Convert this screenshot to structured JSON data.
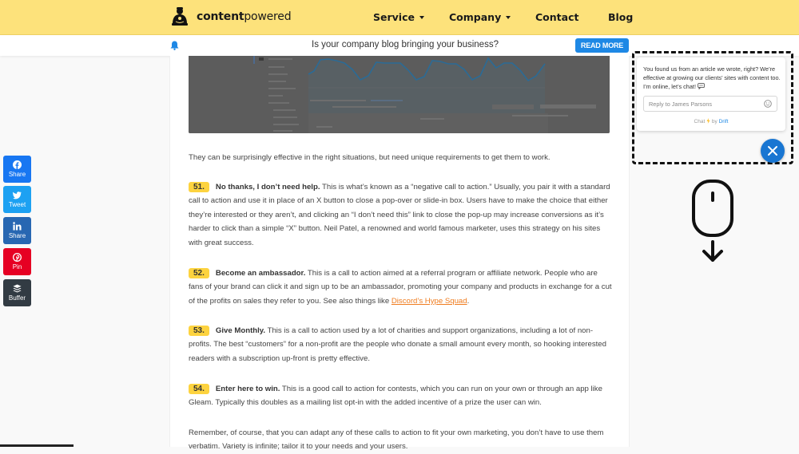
{
  "header": {
    "logo": {
      "name_bold": "content",
      "name_regular": "powered"
    },
    "nav": [
      {
        "label": "Service",
        "has_dropdown": true
      },
      {
        "label": "Company",
        "has_dropdown": true
      },
      {
        "label": "Contact",
        "has_dropdown": false
      },
      {
        "label": "Blog",
        "has_dropdown": false
      }
    ]
  },
  "notice_bar": {
    "icon": "bell-icon",
    "text": "Is your company blog bringing your business?",
    "button_label": "READ MORE",
    "accent": "#1e88e5"
  },
  "social_share": [
    {
      "network": "facebook",
      "icon": "facebook-icon",
      "label": "Share",
      "color": "#1877f2"
    },
    {
      "network": "twitter",
      "icon": "twitter-icon",
      "label": "Tweet",
      "color": "#1da1f2"
    },
    {
      "network": "linkedin",
      "icon": "linkedin-icon",
      "label": "Share",
      "color": "#2867b2"
    },
    {
      "network": "pinterest",
      "icon": "pinterest-icon",
      "label": "Pin",
      "color": "#e60023"
    },
    {
      "network": "buffer",
      "icon": "buffer-icon",
      "label": "Buffer",
      "color": "#323b43"
    }
  ],
  "article": {
    "image_alt": "Analytics dashboard screenshot showing traffic line chart and keyword table",
    "intro": "They can be surprisingly effective in the right situations, but need unique requirements to get them to work.",
    "items": [
      {
        "number": "51.",
        "title": "No thanks, I don’t need help.",
        "body": " This is what’s known as a “negative call to action.” Usually, you pair it with a standard call to action and use it in place of an X button to close a pop-over or slide-in box. Users have to make the choice that either they’re interested or they aren’t, and clicking an “I don’t need this” link to close the pop-up may increase conversions as it’s harder to click than a simple “X” button. Neil Patel, a renowned and world famous marketer, uses this strategy on his sites with great success."
      },
      {
        "number": "52.",
        "title": "Become an ambassador.",
        "body": " This is a call to action aimed at a referral program or affiliate network. People who are fans of your brand can click it and sign up to be an ambassador, promoting your company and products in exchange for a cut of the profits on sales they refer to you. See also things like ",
        "link_text": "Discord’s Hype Squad",
        "after_link": "."
      },
      {
        "number": "53.",
        "title": "Give Monthly.",
        "body": " This is a call to action used by a lot of charities and support organizations, including a lot of non-profits. The best “customers” for a non-profit are the people who donate a small amount every month, so hooking interested readers with a subscription up-front is pretty effective."
      },
      {
        "number": "54.",
        "title": "Enter here to win.",
        "body": " This is a good call to action for contests, which you can run on your own or through an app like Gleam. Typically this doubles as a mailing list opt-in with the added incentive of a prize the user can win."
      }
    ],
    "closing": "Remember, of course, that you can adapt any of these calls to action to fit your own marketing, you don’t have to use them verbatim. Variety is infinite; tailor it to your needs and your users."
  },
  "chat_widget": {
    "message": "You found us from an article we wrote, right? We’re effective at growing our clients’ sites with content too. I’m online, let’s chat!",
    "input_placeholder": "Reply to James Parsons",
    "footer_prefix": "Chat",
    "footer_by": "by",
    "footer_brand": "Drift",
    "close_icon": "close-icon",
    "accent": "#1976d2"
  },
  "scroll_hint": {
    "icon": "mouse-scroll-down-icon"
  }
}
